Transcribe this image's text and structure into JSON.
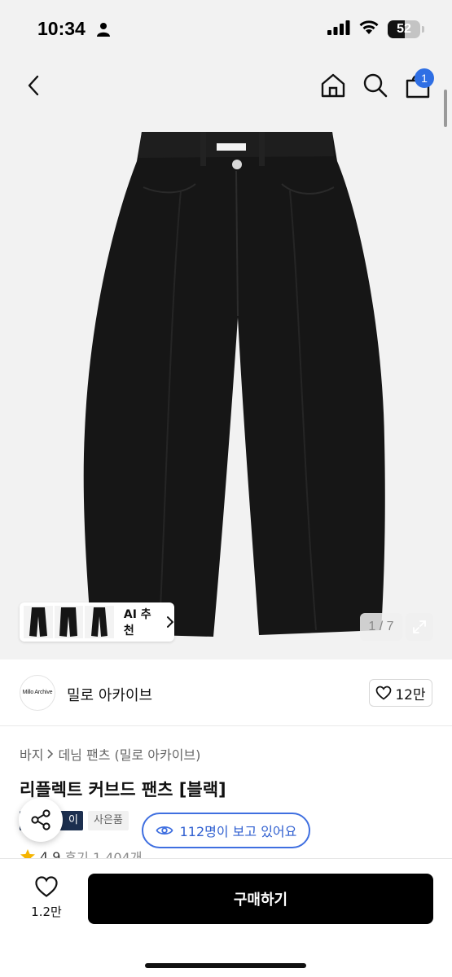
{
  "status_bar": {
    "time": "10:34",
    "battery_level": "52",
    "battery_fraction": 0.52,
    "icons": [
      "person-icon",
      "signal-icon",
      "wifi-icon",
      "battery-icon"
    ]
  },
  "top_nav": {
    "icons": [
      "back-icon",
      "home-icon",
      "search-icon",
      "cart-icon"
    ],
    "cart_count": "1"
  },
  "gallery": {
    "ai_recommend_label": "AI 추천",
    "counter": "1 / 7"
  },
  "seller": {
    "logo_text": "Millo Archive",
    "name": "밀로 아카이브",
    "likes": "12만"
  },
  "breadcrumb": {
    "category": "바지",
    "subcategory": "데님 팬츠 (밀로 아카이브)"
  },
  "product": {
    "title": "리플렉트 커브드 팬츠 [블랙]",
    "tag_dark": "이",
    "tag_light": "사은품",
    "viewers": "112명이 보고 있어요",
    "rating": "4.9",
    "reviews": "후기 1,404개"
  },
  "bottom_bar": {
    "wish_count": "1.2만",
    "buy_label": "구매하기"
  },
  "colors": {
    "accent_blue": "#3f6fe0",
    "badge_blue": "#2f6fe4",
    "tag_navy": "#1c2f4f",
    "star": "#f5b400"
  }
}
